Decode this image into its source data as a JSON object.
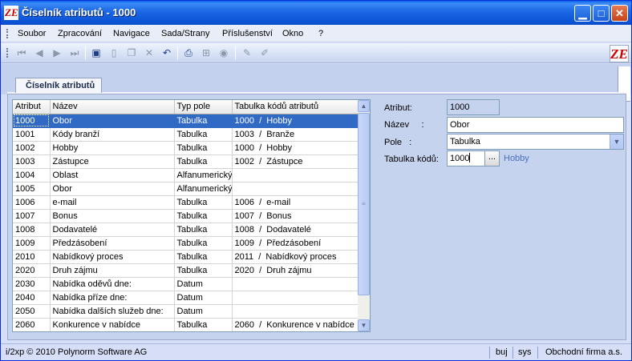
{
  "window": {
    "title": "Číselník atributů - 1000",
    "logo": "ZE"
  },
  "menu": [
    "Soubor",
    "Zpracování",
    "Navigace",
    "Sada/Strany",
    "Příslušenství",
    "Okno",
    "?"
  ],
  "toolbar_icons": [
    "first-record-icon",
    "prev-record-icon",
    "next-record-icon",
    "last-record-icon",
    "save-icon",
    "new-icon",
    "copy-icon",
    "delete-icon",
    "undo-icon",
    "print-icon",
    "tree-icon",
    "help-icon",
    "edit-icon",
    "edit-alt-icon"
  ],
  "tab": {
    "label": "Číselník atributů"
  },
  "grid": {
    "columns": [
      "Atribut",
      "Název",
      "Typ pole",
      "Tabulka kódů atributů"
    ],
    "rows": [
      [
        "1000",
        "Obor",
        "Tabulka",
        "1000  /  Hobby"
      ],
      [
        "1001",
        "Kódy branží",
        "Tabulka",
        "1003  /  Branže"
      ],
      [
        "1002",
        "Hobby",
        "Tabulka",
        "1000  /  Hobby"
      ],
      [
        "1003",
        "Zástupce",
        "Tabulka",
        "1002  /  Zástupce"
      ],
      [
        "1004",
        "Oblast",
        "Alfanumerický",
        ""
      ],
      [
        "1005",
        "Obor",
        "Alfanumerický",
        ""
      ],
      [
        "1006",
        "e-mail",
        "Tabulka",
        "1006  /  e-mail"
      ],
      [
        "1007",
        "Bonus",
        "Tabulka",
        "1007  /  Bonus"
      ],
      [
        "1008",
        "Dodavatelé",
        "Tabulka",
        "1008  /  Dodavatelé"
      ],
      [
        "1009",
        "Předzásobení",
        "Tabulka",
        "1009  /  Předzásobení"
      ],
      [
        "2010",
        "Nabídkový proces",
        "Tabulka",
        "2011  /  Nabídkový proces"
      ],
      [
        "2020",
        "Druh zájmu",
        "Tabulka",
        "2020  /  Druh zájmu"
      ],
      [
        "2030",
        "Nabídka oděvů dne:",
        "Datum",
        ""
      ],
      [
        "2040",
        "Nabídka příze dne:",
        "Datum",
        ""
      ],
      [
        "2050",
        "Nabídka dalších služeb dne:",
        "Datum",
        ""
      ],
      [
        "2060",
        "Konkurence v nabídce",
        "Tabulka",
        "2060  /  Konkurence v nabídce"
      ]
    ],
    "selected_row": 0
  },
  "form": {
    "atribut_label": "Atribut:",
    "atribut_value": "1000",
    "nazev_label": "Název     :",
    "nazev_value": "Obor",
    "pole_label": "Pole   :",
    "pole_value": "Tabulka",
    "tabulka_label": "Tabulka kódů:",
    "tabulka_value": "1000",
    "tabulka_button": "...",
    "tabulka_hint": "Hobby"
  },
  "status": {
    "copyright": "i/2xp © 2010 Polynorm Software AG",
    "user": "buj",
    "db": "sys",
    "company": "Obchodní firma a.s."
  }
}
